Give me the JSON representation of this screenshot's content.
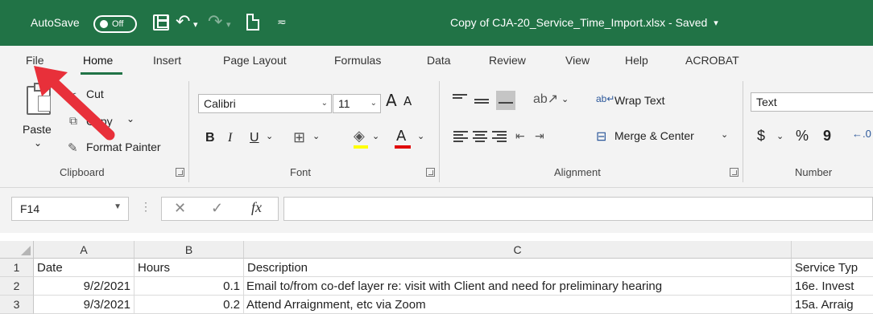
{
  "titlebar": {
    "autosave_label": "AutoSave",
    "autosave_state": "Off",
    "document_title": "Copy of CJA-20_Service_Time_Import.xlsx  -  Saved",
    "caret": "▾",
    "qat_more": "≂",
    "undo_glyph": "↶",
    "redo_glyph": "↷"
  },
  "tabs": [
    "File",
    "Home",
    "Insert",
    "Page Layout",
    "Formulas",
    "Data",
    "Review",
    "View",
    "Help",
    "ACROBAT"
  ],
  "active_tab": "Home",
  "clipboard": {
    "paste_label": "Paste",
    "paste_caret": "⌄",
    "cut_label": "Cut",
    "copy_label": "Copy",
    "copy_caret": "⌄",
    "format_painter_label": "Format Painter",
    "group_label": "Clipboard"
  },
  "font": {
    "font_name": "Calibri",
    "font_size": "11",
    "grow_glyph": "A",
    "shrink_glyph": "A",
    "bold": "B",
    "italic": "I",
    "underline": "U",
    "font_color_letter": "A",
    "group_label": "Font",
    "font_color": "#e00000",
    "fill_color": "#ffff00"
  },
  "alignment": {
    "wrap_text_label": "Wrap Text",
    "merge_center_label": "Merge & Center",
    "group_label": "Alignment"
  },
  "number": {
    "format_value": "Text",
    "currency": "$",
    "percent": "%",
    "comma": "9",
    "group_label": "Number"
  },
  "formula_bar": {
    "name_box": "F14",
    "cancel_glyph": "✕",
    "enter_glyph": "✓",
    "fx_label": "fx",
    "formula": ""
  },
  "sheet": {
    "columns": [
      "A",
      "B",
      "C"
    ],
    "rows": [
      {
        "num": "1",
        "cells": [
          "Date",
          "Hours",
          "Description",
          "Service Typ"
        ]
      },
      {
        "num": "2",
        "cells": [
          "9/2/2021",
          "0.1",
          "Email to/from co-def layer  re: visit with Client and need for preliminary hearing",
          "16e. Invest"
        ]
      },
      {
        "num": "3",
        "cells": [
          "9/3/2021",
          "0.2",
          "Attend Arraignment, etc via Zoom",
          "15a. Arraig"
        ]
      }
    ]
  },
  "colors": {
    "excel_green": "#217346",
    "annotation_red": "#e8303a"
  }
}
